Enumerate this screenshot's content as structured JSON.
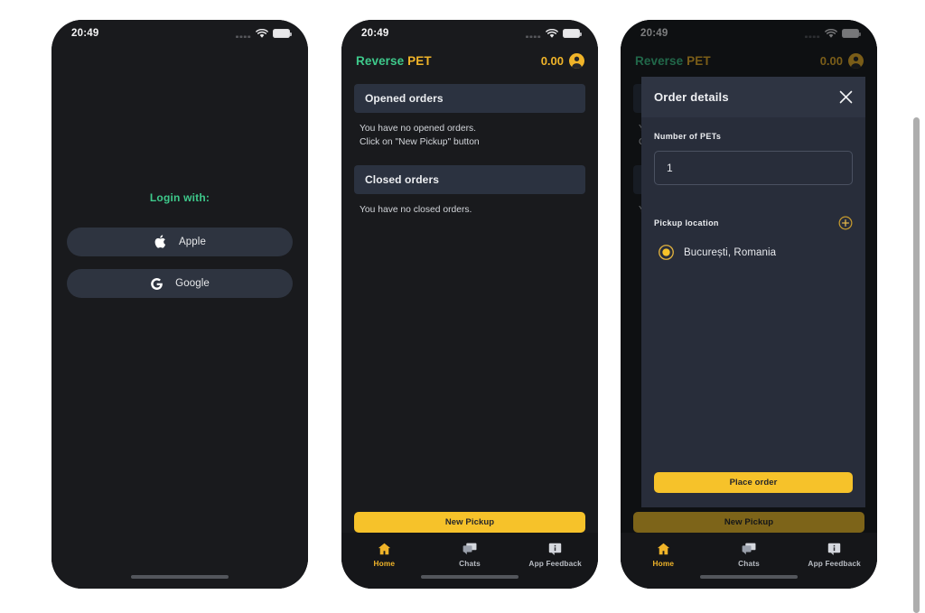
{
  "app": {
    "brand_primary": "Reverse",
    "brand_secondary": "PET",
    "accent_green": "#3ec98b",
    "accent_amber": "#f0b429",
    "button_yellow": "#f6c22a",
    "screen_bg": "#191a1d"
  },
  "status_bar": {
    "time": "20:49",
    "signal_icon": "signal-bars-icon",
    "wifi_icon": "wifi-icon",
    "battery_icon": "battery-icon"
  },
  "header": {
    "balance": "0.00",
    "account_icon": "account-avatar-icon"
  },
  "screen1_login": {
    "title": "Login with:",
    "buttons": [
      {
        "label": "Apple",
        "icon": "apple-logo-icon"
      },
      {
        "label": "Google",
        "icon": "google-logo-icon"
      }
    ]
  },
  "screen2_orders": {
    "sections": [
      {
        "heading": "Opened orders",
        "body_line1": "You have no opened orders.",
        "body_line2": "Click on \"New Pickup\" button"
      },
      {
        "heading": "Closed orders",
        "body_line1": "You have no closed orders.",
        "body_line2": ""
      }
    ],
    "primary_button": "New Pickup"
  },
  "screen3_modal": {
    "title": "Order details",
    "close_icon": "close-x-icon",
    "pets_label": "Number of PETs",
    "pets_value": "1",
    "pets_placeholder": "1",
    "pickup_label": "Pickup location",
    "add_location_icon": "plus-circle-icon",
    "locations": [
      {
        "name": "București, Romania",
        "selected": true,
        "icon": "radio-selected-icon"
      }
    ],
    "primary_button": "Place order"
  },
  "tabbar": {
    "items": [
      {
        "label": "Home",
        "icon": "home-icon",
        "active": true
      },
      {
        "label": "Chats",
        "icon": "chat-bubbles-icon",
        "active": false
      },
      {
        "label": "App Feedback",
        "icon": "feedback-icon",
        "active": false
      }
    ]
  }
}
